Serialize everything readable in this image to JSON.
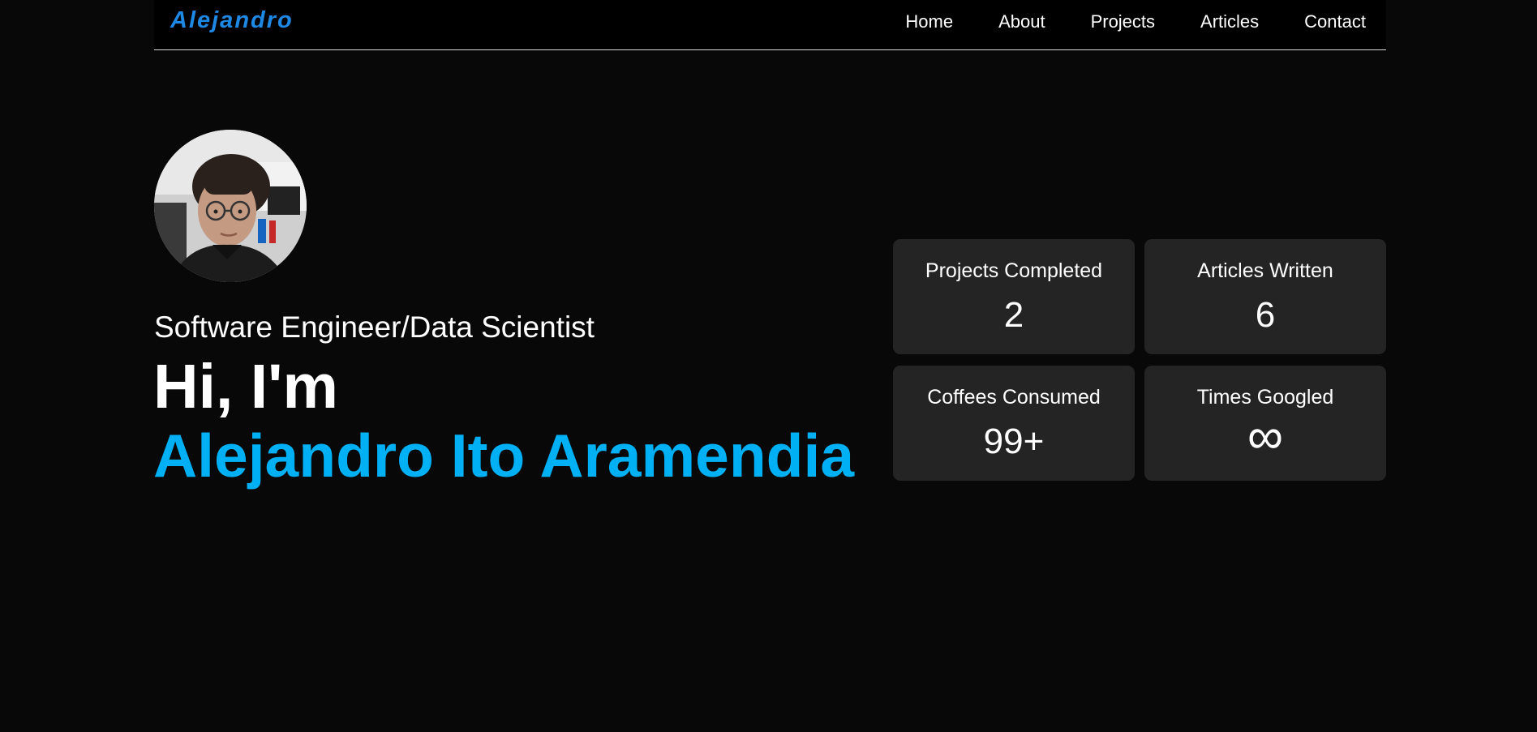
{
  "header": {
    "brand": "Alejandro",
    "nav": [
      "Home",
      "About",
      "Projects",
      "Articles",
      "Contact"
    ]
  },
  "hero": {
    "subtitle": "Software Engineer/Data Scientist",
    "greeting": "Hi, I'm",
    "name": "Alejandro Ito Aramendia"
  },
  "stats": [
    {
      "label": "Projects Completed",
      "value": "2"
    },
    {
      "label": "Articles Written",
      "value": "6"
    },
    {
      "label": "Coffees Consumed",
      "value": "99+"
    },
    {
      "label": "Times Googled",
      "value": "∞"
    }
  ],
  "colors": {
    "background": "#080808",
    "nav_background": "#000000",
    "brand": "#1e88e5",
    "accent_name": "#00b0f5",
    "card": "#242424"
  }
}
